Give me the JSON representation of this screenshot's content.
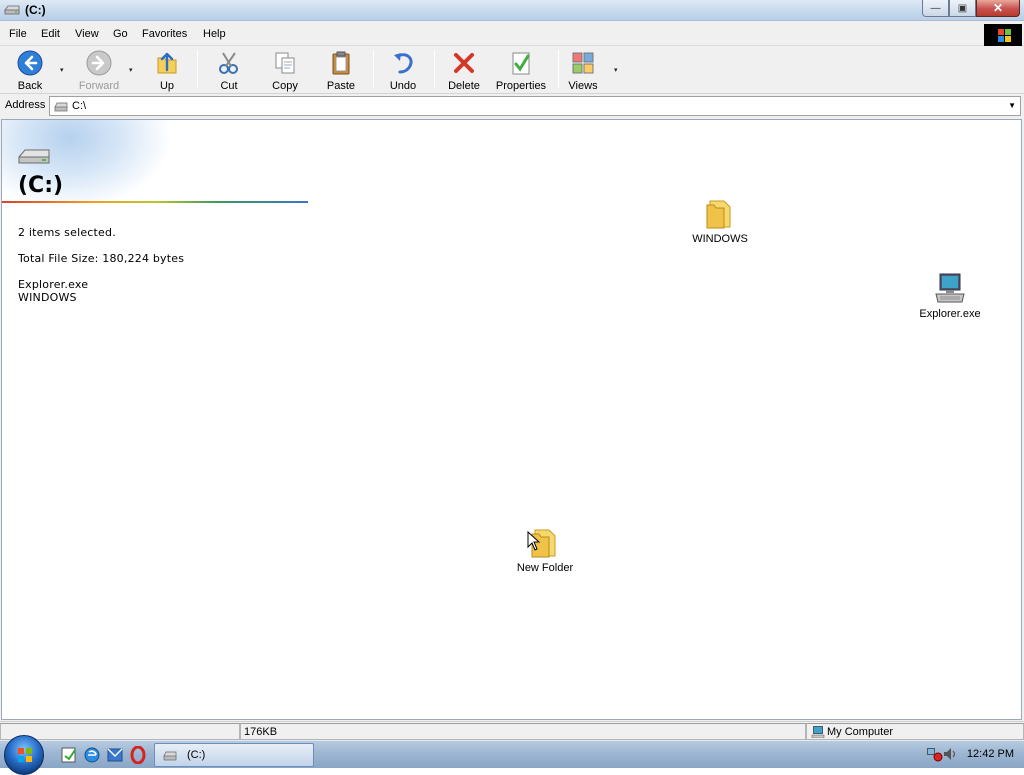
{
  "window": {
    "title": "(C:)",
    "buttons": {
      "minimize": "—",
      "maximize": "▣",
      "close": "✕"
    }
  },
  "menu": {
    "items": [
      {
        "label": "File"
      },
      {
        "label": "Edit"
      },
      {
        "label": "View"
      },
      {
        "label": "Go"
      },
      {
        "label": "Favorites"
      },
      {
        "label": "Help"
      }
    ]
  },
  "toolbar": {
    "back": "Back",
    "forward": "Forward",
    "up": "Up",
    "cut": "Cut",
    "copy": "Copy",
    "paste": "Paste",
    "undo": "Undo",
    "delete": "Delete",
    "properties": "Properties",
    "views": "Views",
    "dropdown_glyph": "▾"
  },
  "address": {
    "label": "Address",
    "value": "C:\\"
  },
  "webview": {
    "title": "(C:)",
    "selection_text": "2 items selected.",
    "file_size_text": "Total File Size: 180,224 bytes",
    "selected_items": [
      "Explorer.exe",
      "WINDOWS"
    ]
  },
  "files": [
    {
      "name": "WINDOWS",
      "type": "folder"
    },
    {
      "name": "Explorer.exe",
      "type": "application"
    },
    {
      "name": "New Folder",
      "type": "folder"
    }
  ],
  "statusbar": {
    "size": "176KB",
    "zone": "My Computer"
  },
  "taskbar": {
    "task_label": "(C:)",
    "clock": "12:42 PM"
  },
  "colors": {
    "folder": "#f4cf5b",
    "accent_blue": "#2a6fc9",
    "close_red": "#c75050"
  }
}
